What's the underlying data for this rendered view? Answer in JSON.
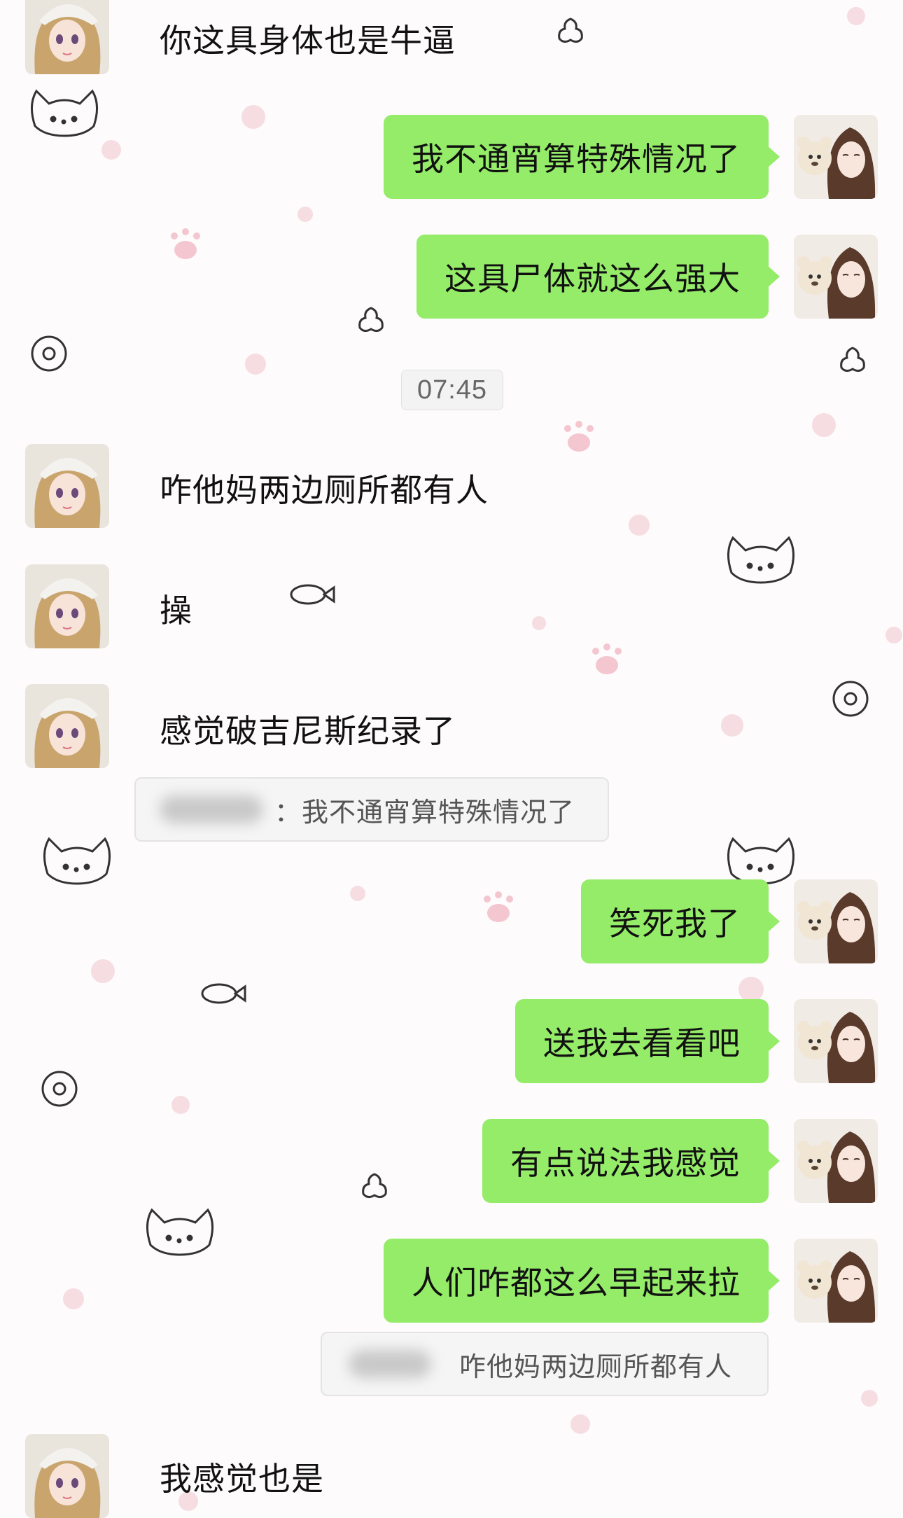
{
  "messages": [
    {
      "side": "left",
      "text": "你这具身体也是牛逼"
    },
    {
      "side": "right",
      "text": "我不通宵算特殊情况了"
    },
    {
      "side": "right",
      "text": "这具尸体就这么强大"
    },
    {
      "side": "time",
      "text": "07:45"
    },
    {
      "side": "left",
      "text": "咋他妈两边厕所都有人"
    },
    {
      "side": "left",
      "text": "操"
    },
    {
      "side": "left",
      "text": "感觉破吉尼斯纪录了"
    },
    {
      "side": "quote",
      "sender_suffix": "：",
      "text": "我不通宵算特殊情况了"
    },
    {
      "side": "right",
      "text": "笑死我了"
    },
    {
      "side": "right",
      "text": "送我去看看吧"
    },
    {
      "side": "right",
      "text": "有点说法我感觉"
    },
    {
      "side": "right",
      "text": "人们咋都这么早起来拉"
    },
    {
      "side": "quote",
      "sender_suffix": "",
      "text": "咋他妈两边厕所都有人"
    },
    {
      "side": "left",
      "text": "我感觉也是"
    }
  ],
  "colors": {
    "bubble_outgoing": "#95ec69",
    "background": "#fdfbfc",
    "quote_background": "#f5f5f5"
  },
  "icons": {
    "left_avatar": "anime-girl-white-hat-avatar",
    "right_avatar": "girl-with-teddy-bear-avatar"
  }
}
